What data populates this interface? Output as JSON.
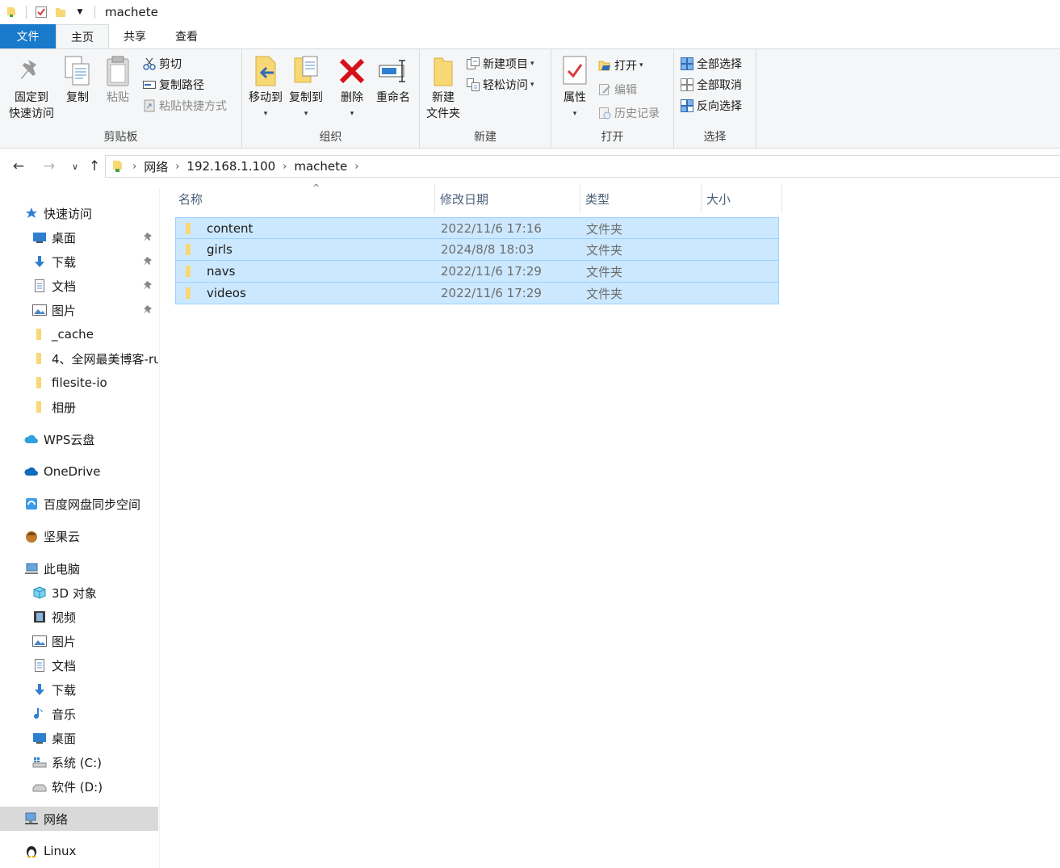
{
  "window": {
    "title": "machete"
  },
  "ribbon_tabs": [
    {
      "label": "文件"
    },
    {
      "label": "主页"
    },
    {
      "label": "共享"
    },
    {
      "label": "查看"
    }
  ],
  "ribbon": {
    "clipboard": {
      "label": "剪贴板",
      "pin_line1": "固定到",
      "pin_line2": "快速访问",
      "copy": "复制",
      "paste": "粘贴",
      "cut": "剪切",
      "copy_path": "复制路径",
      "paste_shortcut": "粘贴快捷方式"
    },
    "organize": {
      "label": "组织",
      "move_to": "移动到",
      "copy_to": "复制到",
      "delete": "删除",
      "rename": "重命名"
    },
    "new": {
      "label": "新建",
      "new_folder_line1": "新建",
      "new_folder_line2": "文件夹",
      "new_item": "新建项目",
      "easy_access": "轻松访问"
    },
    "open": {
      "label": "打开",
      "properties": "属性",
      "open": "打开",
      "edit": "编辑",
      "history": "历史记录"
    },
    "select": {
      "label": "选择",
      "select_all": "全部选择",
      "select_none": "全部取消",
      "invert": "反向选择"
    }
  },
  "address": {
    "crumbs": [
      "网络",
      "192.168.1.100",
      "machete"
    ]
  },
  "sidebar": {
    "items": [
      {
        "label": "快速访问",
        "icon": "star-icon"
      },
      {
        "label": "桌面",
        "icon": "desktop-icon",
        "pinned": true
      },
      {
        "label": "下载",
        "icon": "download-icon",
        "pinned": true
      },
      {
        "label": "文档",
        "icon": "document-icon",
        "pinned": true
      },
      {
        "label": "图片",
        "icon": "pictures-icon",
        "pinned": true
      },
      {
        "label": "_cache",
        "icon": "folder-icon"
      },
      {
        "label": "4、全网最美博客-ru",
        "icon": "folder-icon"
      },
      {
        "label": "filesite-io",
        "icon": "folder-icon"
      },
      {
        "label": "相册",
        "icon": "folder-icon"
      },
      {
        "label": "WPS云盘",
        "icon": "wps-cloud-icon"
      },
      {
        "label": "OneDrive",
        "icon": "onedrive-icon"
      },
      {
        "label": "百度网盘同步空间",
        "icon": "baidu-netdisk-icon"
      },
      {
        "label": "坚果云",
        "icon": "nutstore-icon"
      },
      {
        "label": "此电脑",
        "icon": "computer-icon"
      },
      {
        "label": "3D 对象",
        "icon": "3d-objects-icon"
      },
      {
        "label": "视频",
        "icon": "videos-icon"
      },
      {
        "label": "图片",
        "icon": "pictures-icon"
      },
      {
        "label": "文档",
        "icon": "document-icon"
      },
      {
        "label": "下载",
        "icon": "download-icon"
      },
      {
        "label": "音乐",
        "icon": "music-icon"
      },
      {
        "label": "桌面",
        "icon": "desktop-icon"
      },
      {
        "label": "系统 (C:)",
        "icon": "drive-c-icon"
      },
      {
        "label": "软件 (D:)",
        "icon": "drive-icon"
      },
      {
        "label": "网络",
        "icon": "network-icon",
        "selected": true
      },
      {
        "label": "Linux",
        "icon": "linux-icon"
      }
    ]
  },
  "filelist": {
    "columns": {
      "name": "名称",
      "modified": "修改日期",
      "type": "类型",
      "size": "大小"
    },
    "rows": [
      {
        "name": "content",
        "modified": "2022/11/6 17:16",
        "type": "文件夹"
      },
      {
        "name": "girls",
        "modified": "2024/8/8 18:03",
        "type": "文件夹"
      },
      {
        "name": "navs",
        "modified": "2022/11/6 17:29",
        "type": "文件夹"
      },
      {
        "name": "videos",
        "modified": "2022/11/6 17:29",
        "type": "文件夹"
      }
    ]
  },
  "colors": {
    "file_tab": "#1979ca",
    "selection": "#cce8ff",
    "selection_border": "#99d1ff",
    "folder": "#f8d775"
  }
}
